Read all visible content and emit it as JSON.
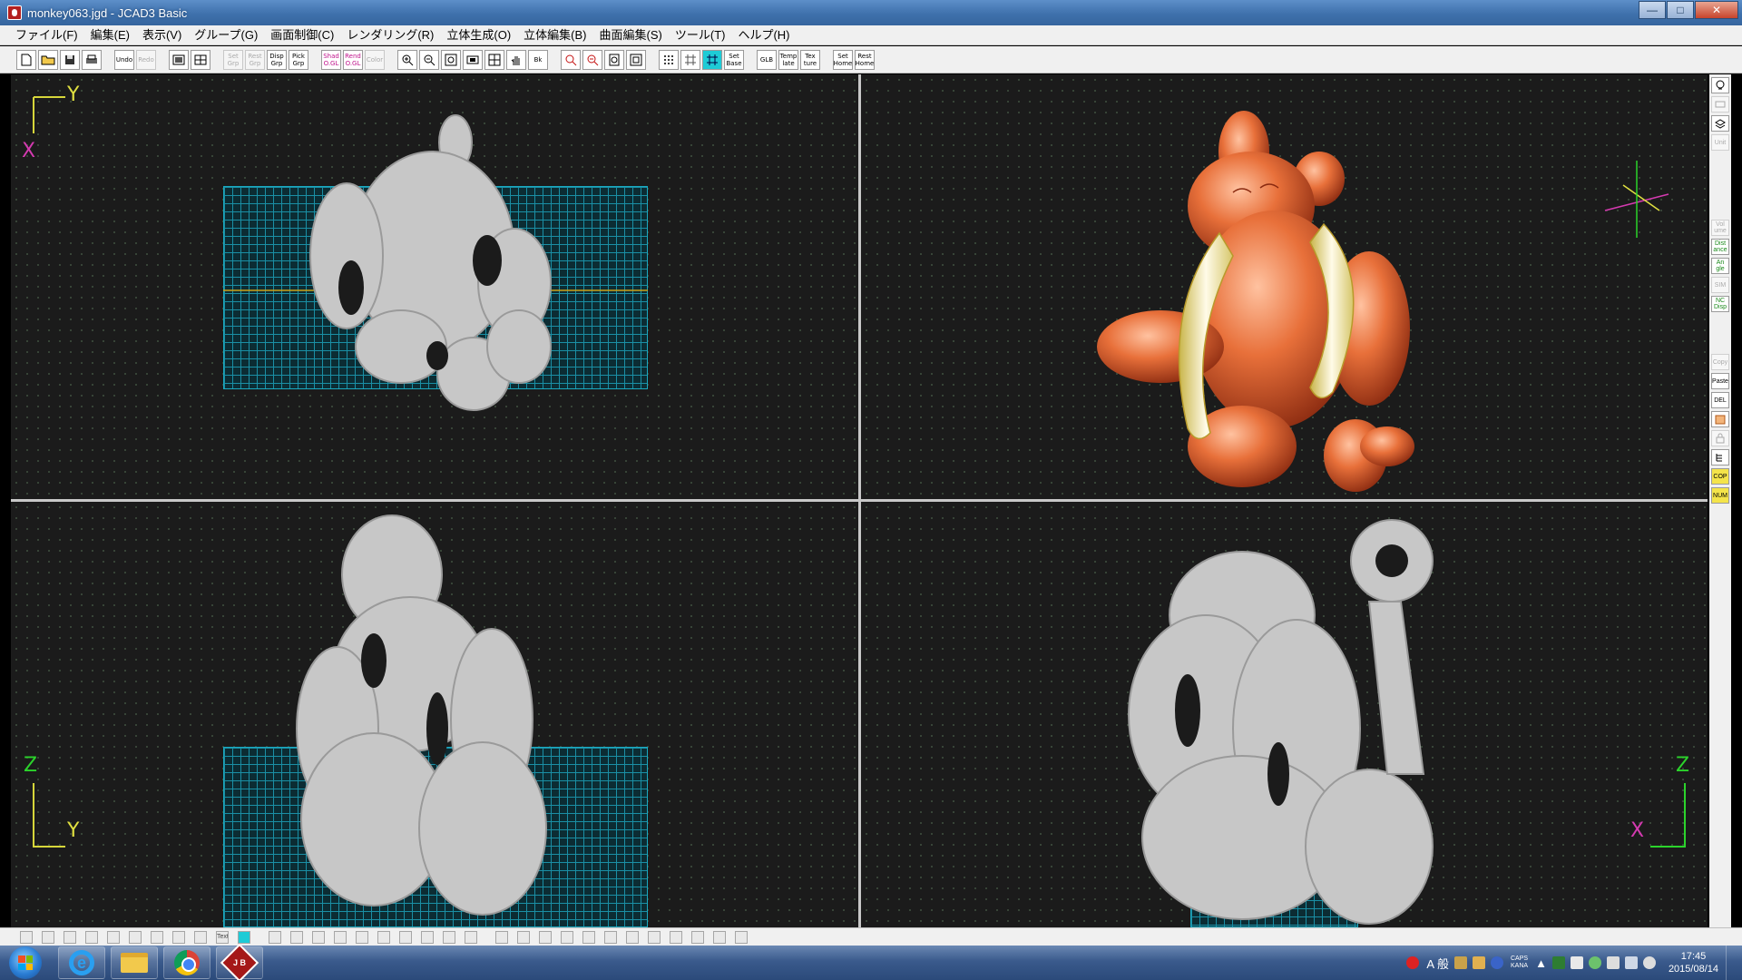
{
  "window": {
    "title": "monkey063.jgd - JCAD3 Basic",
    "controls": {
      "minimize": "—",
      "maximize": "□",
      "close": "✕"
    }
  },
  "menu": {
    "items": [
      "ファイル(F)",
      "編集(E)",
      "表示(V)",
      "グループ(G)",
      "画面制御(C)",
      "レンダリング(R)",
      "立体生成(O)",
      "立体編集(B)",
      "曲面編集(S)",
      "ツール(T)",
      "ヘルプ(H)"
    ]
  },
  "toolbar": {
    "undo": "Undo",
    "redo": "Redo",
    "set_grp": "Set Grp",
    "rest_grp": "Rest Grp",
    "disp_grp": "Disp Grp",
    "pick_grp": "Pick Grp",
    "shad_0gl": "Shad O.GL",
    "rend_0gl": "Rend O.GL",
    "color": "Color",
    "bk": "Bk",
    "set_base": "Set Base",
    "glb": "GLB",
    "template": "Temp late",
    "texture": "Tex ture",
    "set_home": "Set Home",
    "rest_home": "Rest Home"
  },
  "viewports": {
    "top": {
      "axis_v": "Y",
      "axis_h": "X"
    },
    "front": {
      "axis_v": "Z",
      "axis_h": "Y"
    },
    "side": {
      "axis_v": "Z",
      "axis_h": "X"
    }
  },
  "side_strip": {
    "unit": "Unit",
    "vol": "Vol ume",
    "distance": "Dist ance",
    "angle": "An gle",
    "sim": "SIM",
    "nc_disp": "NC Disp",
    "copy": "Copy",
    "paste": "Paste",
    "del": "DEL",
    "cop": "COP",
    "num": "NUM"
  },
  "bottom_toolbar": {
    "text": "Text"
  },
  "taskbar": {
    "jcad_label": "J B",
    "ime": "A 般",
    "caps": "CAPS",
    "kana": "KANA",
    "time": "17:45",
    "date": "2015/08/14"
  },
  "colors": {
    "viewport_bg": "#1b1b1b",
    "grid_plate": "#1aa9c0",
    "model_wire": "#cfcfcf",
    "render_body": "#e8703a",
    "render_banana": "#f3f0c8"
  }
}
